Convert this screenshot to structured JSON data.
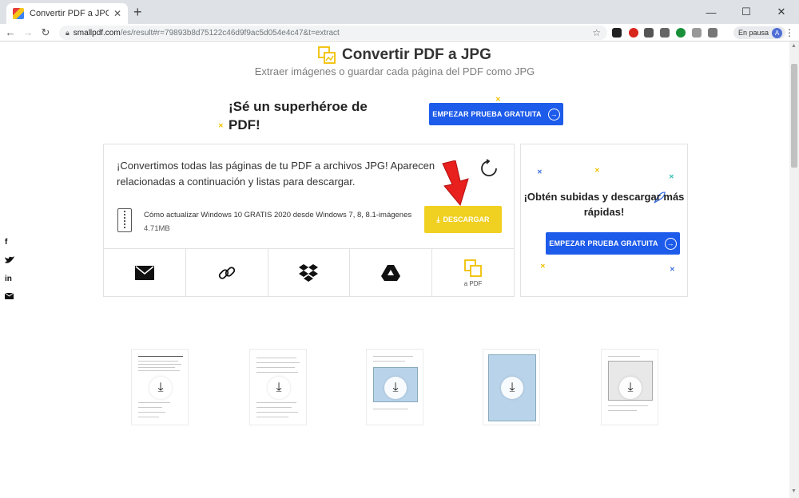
{
  "browser": {
    "tab_title": "Convertir PDF a JPG – Convierte",
    "url_host": "smallpdf.com",
    "url_path": "/es/result#r=79893b8d75122c46d9f9ac5d054e4c47&t=extract",
    "profile_status": "En pausa",
    "profile_initial": "A"
  },
  "header": {
    "title": "Convertir PDF a JPG",
    "subtitle": "Extraer imágenes o guardar cada página del PDF como JPG"
  },
  "promo": {
    "text": "¡Sé un superhéroe de PDF!",
    "button_label": "EMPEZAR PRUEBA GRATUITA"
  },
  "result": {
    "message": "¡Convertimos todas las páginas de tu PDF a archivos JPG! Aparecen relacionadas a continuación y listas para descargar.",
    "file_name": "Cómo actualizar Windows 10 GRATIS 2020 desde Windows 7, 8, 8.1-imágenes",
    "file_size": "4.71MB",
    "download_label": "DESCARGAR",
    "share": [
      {
        "icon": "email-icon",
        "label": ""
      },
      {
        "icon": "link-icon",
        "label": ""
      },
      {
        "icon": "dropbox-icon",
        "label": ""
      },
      {
        "icon": "google-drive-icon",
        "label": ""
      },
      {
        "icon": "to-pdf-icon",
        "label": "a PDF"
      }
    ]
  },
  "sidebar_promo": {
    "title": "¡Obtén subidas y descargar más rápidas!",
    "button_label": "EMPEZAR PRUEBA GRATUITA"
  },
  "social": [
    "f",
    "t",
    "in",
    "mail"
  ],
  "colors": {
    "accent_blue": "#1d5bea",
    "download_yellow": "#f0d020",
    "arrow_red": "#e8201e"
  }
}
